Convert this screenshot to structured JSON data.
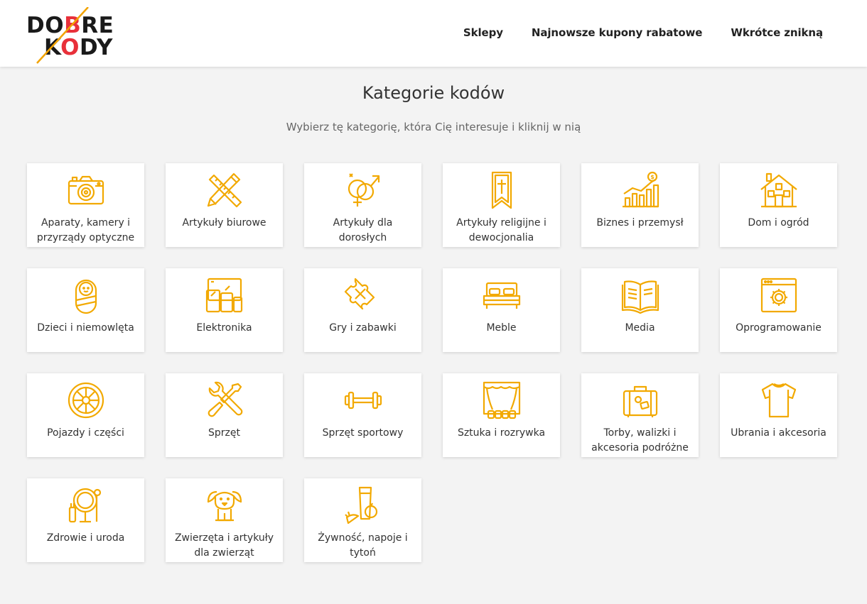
{
  "brand": {
    "line1_left": "DO",
    "line1_accent": "B",
    "line1_right": "RE",
    "line2_left": "K",
    "line2_accent": "O",
    "line2_right": "DY",
    "colors": {
      "text": "#1a1a1a",
      "accent": "#e8303a",
      "slash": "#f2a300"
    }
  },
  "nav": {
    "items": [
      {
        "label": "Sklepy"
      },
      {
        "label": "Najnowsze kupony rabatowe"
      },
      {
        "label": "Wkrótce znikną"
      }
    ]
  },
  "main": {
    "title": "Kategorie kodów",
    "subtitle": "Wybierz tę kategorię, która Cię interesuje i kliknij w nią"
  },
  "icon_color": "#f2a900",
  "categories": [
    {
      "label": "Aparaty, kamery i przyrządy optyczne",
      "icon": "camera-icon"
    },
    {
      "label": "Artykuły biurowe",
      "icon": "pencil-ruler-icon"
    },
    {
      "label": "Artykuły dla dorosłych",
      "icon": "gender-rings-icon"
    },
    {
      "label": "Artykuły religijne i dewocjonalia",
      "icon": "cross-banner-icon"
    },
    {
      "label": "Biznes i przemysł",
      "icon": "growth-chart-icon"
    },
    {
      "label": "Dom i ogród",
      "icon": "house-icon"
    },
    {
      "label": "Dzieci i niemowlęta",
      "icon": "baby-icon"
    },
    {
      "label": "Elektronika",
      "icon": "devices-icon"
    },
    {
      "label": "Gry i zabawki",
      "icon": "puzzle-icon"
    },
    {
      "label": "Meble",
      "icon": "bed-icon"
    },
    {
      "label": "Media",
      "icon": "book-icon"
    },
    {
      "label": "Oprogramowanie",
      "icon": "software-gear-icon"
    },
    {
      "label": "Pojazdy i części",
      "icon": "wheel-icon"
    },
    {
      "label": "Sprzęt",
      "icon": "wrench-screwdriver-icon"
    },
    {
      "label": "Sprzęt sportowy",
      "icon": "dumbbell-icon"
    },
    {
      "label": "Sztuka i rozrywka",
      "icon": "theater-icon"
    },
    {
      "label": "Torby, walizki i akcesoria podróżne",
      "icon": "suitcase-icon"
    },
    {
      "label": "Ubrania i akcesoria",
      "icon": "tshirt-icon"
    },
    {
      "label": "Zdrowie i uroda",
      "icon": "mirror-cosmetics-icon"
    },
    {
      "label": "Zwierzęta i artykuły dla zwierząt",
      "icon": "dog-icon"
    },
    {
      "label": "Żywność, napoje i tytoń",
      "icon": "food-drink-icon"
    }
  ]
}
